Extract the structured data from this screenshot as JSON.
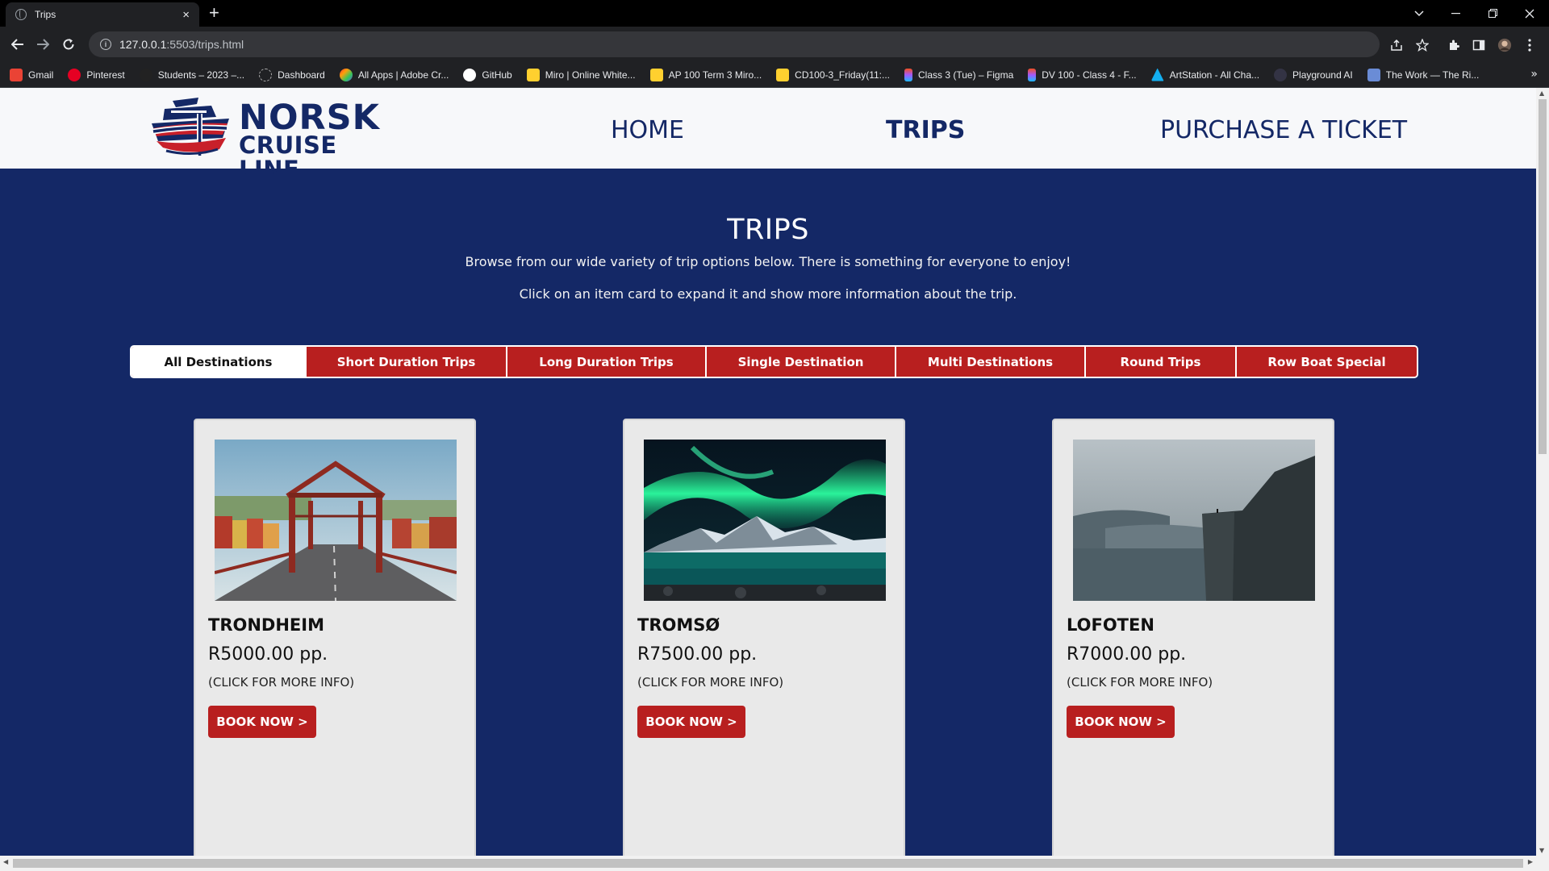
{
  "browser": {
    "tab_title": "Trips",
    "tab_close": "×",
    "new_tab": "+",
    "url_host": "127.0.0.1",
    "url_path": ":5503/trips.html",
    "bookmarks": [
      {
        "label": "Gmail",
        "color": "#ea4335"
      },
      {
        "label": "Pinterest",
        "color": "#e60023"
      },
      {
        "label": "Students – 2023 –...",
        "color": "#222222"
      },
      {
        "label": "Dashboard",
        "color": "#444444"
      },
      {
        "label": "All Apps | Adobe Cr...",
        "color": "#da1f26"
      },
      {
        "label": "GitHub",
        "color": "#ffffff"
      },
      {
        "label": "Miro | Online White...",
        "color": "#ffd02f"
      },
      {
        "label": "AP 100 Term 3 Miro...",
        "color": "#ffd02f"
      },
      {
        "label": "CD100-3_Friday(11:...",
        "color": "#ffd02f"
      },
      {
        "label": "Class 3 (Tue) – Figma",
        "color": "#a259ff"
      },
      {
        "label": "DV 100 - Class 4 - F...",
        "color": "#a259ff"
      },
      {
        "label": "ArtStation - All Cha...",
        "color": "#13aff0"
      },
      {
        "label": "Playground AI",
        "color": "#333344"
      },
      {
        "label": "The Work — The Ri...",
        "color": "#6a8cd6"
      }
    ],
    "bookmarks_more": "»"
  },
  "site": {
    "logo_line1": "NORSK",
    "logo_line2": "CRUISE LINE",
    "nav": [
      {
        "label": "HOME",
        "active": false
      },
      {
        "label": "TRIPS",
        "active": true
      },
      {
        "label": "PURCHASE A TICKET",
        "active": false
      }
    ]
  },
  "intro": {
    "title": "TRIPS",
    "line1": "Browse from our wide variety of trip options below. There is something for everyone to enjoy!",
    "line2": "Click on an item card to expand it and show more information about the trip."
  },
  "filters": [
    {
      "label": "All Destinations",
      "active": true
    },
    {
      "label": "Short Duration Trips",
      "active": false
    },
    {
      "label": "Long Duration Trips",
      "active": false
    },
    {
      "label": "Single Destination",
      "active": false
    },
    {
      "label": "Multi Destinations",
      "active": false
    },
    {
      "label": "Round Trips",
      "active": false
    },
    {
      "label": "Row Boat Special",
      "active": false
    }
  ],
  "cards": [
    {
      "name": "TRONDHEIM",
      "price": "R5000.00 pp.",
      "more": "(CLICK FOR MORE INFO)",
      "button": "BOOK NOW >"
    },
    {
      "name": "TROMSØ",
      "price": "R7500.00 pp.",
      "more": "(CLICK FOR MORE INFO)",
      "button": "BOOK NOW >"
    },
    {
      "name": "LOFOTEN",
      "price": "R7000.00 pp.",
      "more": "(CLICK FOR MORE INFO)",
      "button": "BOOK NOW >"
    }
  ],
  "colors": {
    "brand_navy": "#142866",
    "brand_red": "#b81f1f",
    "card_bg": "#e9e9e9"
  }
}
